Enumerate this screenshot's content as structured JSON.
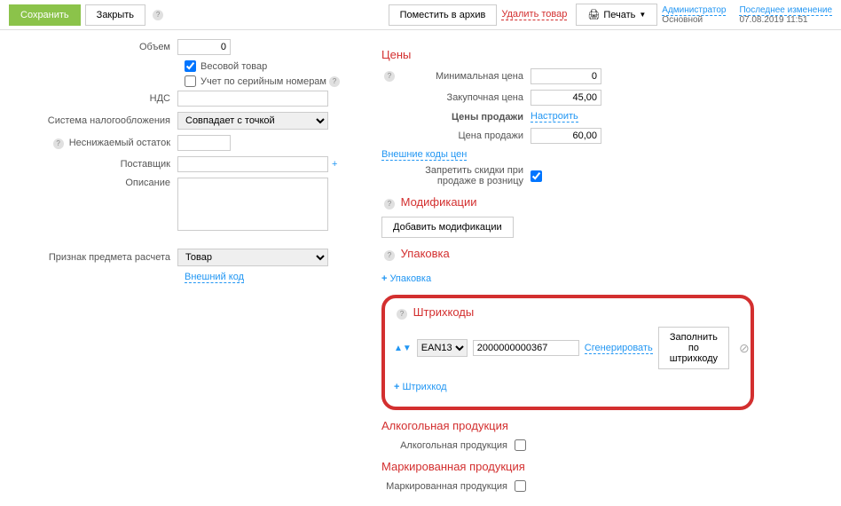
{
  "toolbar": {
    "save": "Сохранить",
    "close": "Закрыть",
    "archive": "Поместить в архив",
    "delete": "Удалить товар",
    "print": "Печать",
    "admin": "Администратор",
    "admin_sub": "Основной",
    "last_change": "Последнее изменение",
    "last_change_date": "07.08.2019 11:51"
  },
  "left": {
    "volume_label": "Объем",
    "volume_value": "0",
    "weight_product": "Весовой товар",
    "serial_tracking": "Учет по серийным номерам",
    "vat_label": "НДС",
    "vat_value": "",
    "tax_system_label": "Система налогообложения",
    "tax_system_value": "Совпадает с точкой",
    "min_stock_label": "Неснижаемый остаток",
    "min_stock_value": "",
    "supplier_label": "Поставщик",
    "supplier_value": "",
    "description_label": "Описание",
    "description_value": "",
    "item_type_label": "Признак предмета расчета",
    "item_type_value": "Товар",
    "external_code": "Внешний код"
  },
  "right": {
    "prices_title": "Цены",
    "min_price_label": "Минимальная цена",
    "min_price_value": "0",
    "purchase_price_label": "Закупочная цена",
    "purchase_price_value": "45,00",
    "sale_prices_label": "Цены продажи",
    "configure": "Настроить",
    "sale_price_label": "Цена продажи",
    "sale_price_value": "60,00",
    "external_price_codes": "Внешние коды цен",
    "disable_discount_label": "Запретить скидки при продаже в розницу",
    "modifications_title": "Модификации",
    "add_modifications": "Добавить модификации",
    "packaging_title": "Упаковка",
    "add_packaging": "Упаковка",
    "barcodes_title": "Штрихкоды",
    "barcode_type": "EAN13",
    "barcode_value": "2000000000367",
    "generate": "Сгенерировать",
    "fill_by_barcode": "Заполнить по штрихкоду",
    "add_barcode": "Штрихкод",
    "alcohol_title": "Алкогольная продукция",
    "alcohol_label": "Алкогольная продукция",
    "marked_title": "Маркированная продукция",
    "marked_label": "Маркированная продукция"
  }
}
